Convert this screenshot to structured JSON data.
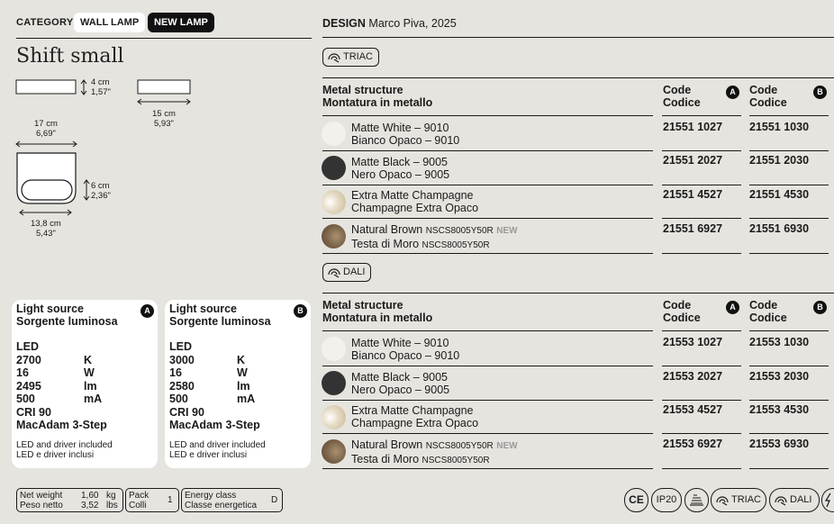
{
  "header": {
    "category_label": "CATEGORY",
    "chips": [
      "WALL LAMP",
      "NEW LAMP"
    ],
    "title": "Shift small",
    "design_label": "DESIGN",
    "designer": "Marco Piva, 2025"
  },
  "dimensions": {
    "d1": [
      "4 cm",
      "1,57\""
    ],
    "d2": [
      "15 cm",
      "5,93\""
    ],
    "d3": [
      "17 cm",
      "6,69\""
    ],
    "d4": [
      "6 cm",
      "2,36\""
    ],
    "d5": [
      "13,8 cm",
      "5,43\""
    ]
  },
  "light_sources": [
    {
      "title": [
        "Light source",
        "Sorgente luminosa"
      ],
      "badge": "A",
      "specs": [
        [
          "LED",
          ""
        ],
        [
          "2700",
          "K"
        ],
        [
          "16",
          "W"
        ],
        [
          "2495",
          "lm"
        ],
        [
          "500",
          "mA"
        ],
        [
          "CRI 90",
          ""
        ],
        [
          "MacAdam 3-Step",
          ""
        ]
      ],
      "note": [
        "LED and driver included",
        "LED e driver inclusi"
      ]
    },
    {
      "title": [
        "Light source",
        "Sorgente luminosa"
      ],
      "badge": "B",
      "specs": [
        [
          "LED",
          ""
        ],
        [
          "3000",
          "K"
        ],
        [
          "16",
          "W"
        ],
        [
          "2580",
          "lm"
        ],
        [
          "500",
          "mA"
        ],
        [
          "CRI 90",
          ""
        ],
        [
          "MacAdam 3-Step",
          ""
        ]
      ],
      "note": [
        "LED and driver included",
        "LED e driver inclusi"
      ]
    }
  ],
  "footer": {
    "weight": [
      [
        "Net weight",
        "1,60",
        "kg"
      ],
      [
        "Peso netto",
        "3,52",
        "lbs"
      ]
    ],
    "pack": [
      [
        "Pack",
        "1"
      ],
      [
        "Colli",
        ""
      ]
    ],
    "energy": [
      [
        "Energy class",
        "D"
      ],
      [
        "Classe energetica",
        ""
      ]
    ],
    "symbols": [
      "CE",
      "IP20",
      "TRIAC",
      "DALI"
    ]
  },
  "tables": [
    {
      "control": "TRIAC",
      "header": [
        "Metal structure",
        "Montatura in metallo"
      ],
      "code_a": [
        "Code",
        "Codice",
        "A"
      ],
      "code_b": [
        "Code",
        "Codice",
        "B"
      ],
      "rows": [
        {
          "name": "Matte White – 9010",
          "name_it": "Bianco Opaco – 9010",
          "code_a": "21551 1027",
          "code_b": "21551 1030",
          "color": "#f2f1ee"
        },
        {
          "name": "Matte Black – 9005",
          "name_it": "Nero Opaco – 9005",
          "code_a": "21551 2027",
          "code_b": "21551 2030",
          "color": "#333333"
        },
        {
          "name": "Extra Matte Champagne",
          "name_it": "Champagne Extra Opaco",
          "code_a": "21551 4527",
          "code_b": "21551 4530",
          "color": "#e4d9c2"
        },
        {
          "name": "Natural Brown",
          "name_suffix": "NSCS8005Y50R",
          "badge": "NEW",
          "name_it": "Testa di Moro",
          "name_it_suffix": "NSCS8005Y50R",
          "code_a": "21551 6927",
          "code_b": "21551 6930",
          "color": "#7a6248"
        }
      ]
    },
    {
      "control": "DALI",
      "header": [
        "Metal structure",
        "Montatura in metallo"
      ],
      "code_a": [
        "Code",
        "Codice",
        "A"
      ],
      "code_b": [
        "Code",
        "Codice",
        "B"
      ],
      "rows": [
        {
          "name": "Matte White – 9010",
          "name_it": "Bianco Opaco – 9010",
          "code_a": "21553 1027",
          "code_b": "21553 1030",
          "color": "#f2f1ee"
        },
        {
          "name": "Matte Black – 9005",
          "name_it": "Nero Opaco – 9005",
          "code_a": "21553 2027",
          "code_b": "21553 2030",
          "color": "#333333"
        },
        {
          "name": "Extra Matte Champagne",
          "name_it": "Champagne Extra Opaco",
          "code_a": "21553 4527",
          "code_b": "21553 4530",
          "color": "#e4d9c2"
        },
        {
          "name": "Natural Brown",
          "name_suffix": "NSCS8005Y50R",
          "badge": "NEW",
          "name_it": "Testa di Moro",
          "name_it_suffix": "NSCS8005Y50R",
          "code_a": "21553 6927",
          "code_b": "21553 6930",
          "color": "#7a6248"
        }
      ]
    }
  ]
}
